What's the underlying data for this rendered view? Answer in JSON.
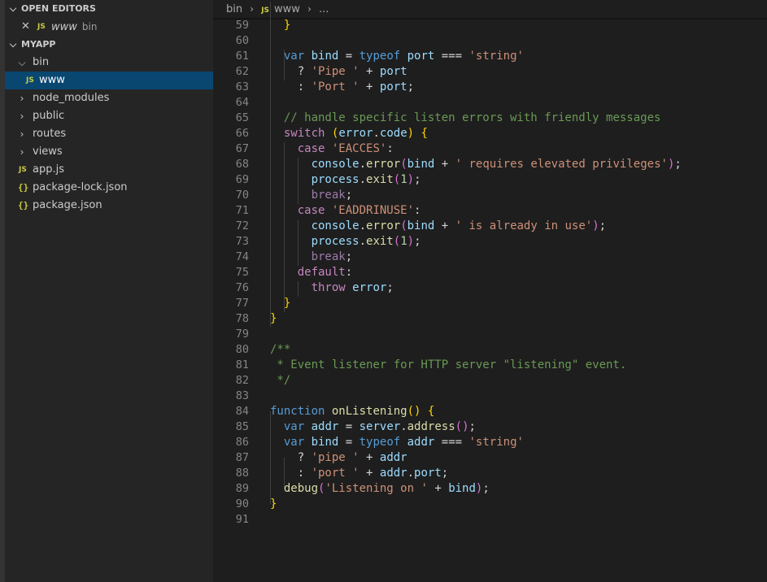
{
  "sidebar": {
    "open_editors": {
      "header": "OPEN EDITORS",
      "items": [
        {
          "icon": "JS",
          "name": "www",
          "description": "bin"
        }
      ]
    },
    "project": {
      "header": "MYAPP",
      "items": [
        {
          "type": "folder",
          "name": "bin",
          "expanded": true
        },
        {
          "type": "file",
          "icon": "JS",
          "name": "www",
          "selected": true
        },
        {
          "type": "folder",
          "name": "node_modules",
          "expanded": false
        },
        {
          "type": "folder",
          "name": "public",
          "expanded": false
        },
        {
          "type": "folder",
          "name": "routes",
          "expanded": false
        },
        {
          "type": "folder",
          "name": "views",
          "expanded": false
        },
        {
          "type": "file",
          "icon": "JS",
          "name": "app.js"
        },
        {
          "type": "file",
          "icon": "{}",
          "name": "package-lock.json"
        },
        {
          "type": "file",
          "icon": "{}",
          "name": "package.json"
        }
      ]
    }
  },
  "breadcrumb": {
    "folder": "bin",
    "file_icon": "JS",
    "file": "www",
    "tail": "..."
  },
  "editor": {
    "line_numbers": [
      "59",
      "60",
      "61",
      "62",
      "63",
      "64",
      "65",
      "66",
      "67",
      "68",
      "69",
      "70",
      "71",
      "72",
      "73",
      "74",
      "75",
      "76",
      "77",
      "78",
      "79",
      "80",
      "81",
      "82",
      "83",
      "84",
      "85",
      "86",
      "87",
      "88",
      "89",
      "90",
      "91"
    ],
    "lines": [
      "  }",
      "",
      "  var bind = typeof port === 'string'",
      "    ? 'Pipe ' + port",
      "    : 'Port ' + port;",
      "",
      "  // handle specific listen errors with friendly messages",
      "  switch (error.code) {",
      "    case 'EACCES':",
      "      console.error(bind + ' requires elevated privileges');",
      "      process.exit(1);",
      "      break;",
      "    case 'EADDRINUSE':",
      "      console.error(bind + ' is already in use');",
      "      process.exit(1);",
      "      break;",
      "    default:",
      "      throw error;",
      "  }",
      "}",
      "",
      "/**",
      " * Event listener for HTTP server \"listening\" event.",
      " */",
      "",
      "function onListening() {",
      "  var addr = server.address();",
      "  var bind = typeof addr === 'string'",
      "    ? 'pipe ' + addr",
      "    : 'port ' + addr.port;",
      "  debug('Listening on ' + bind);",
      "}",
      ""
    ]
  },
  "colors": {
    "keyword": "#569cd6",
    "control": "#c586c0",
    "variable": "#9cdcfe",
    "string": "#ce9178",
    "comment": "#6a9955",
    "function": "#dcdcaa",
    "number": "#b5cea8",
    "selection": "#094771"
  }
}
